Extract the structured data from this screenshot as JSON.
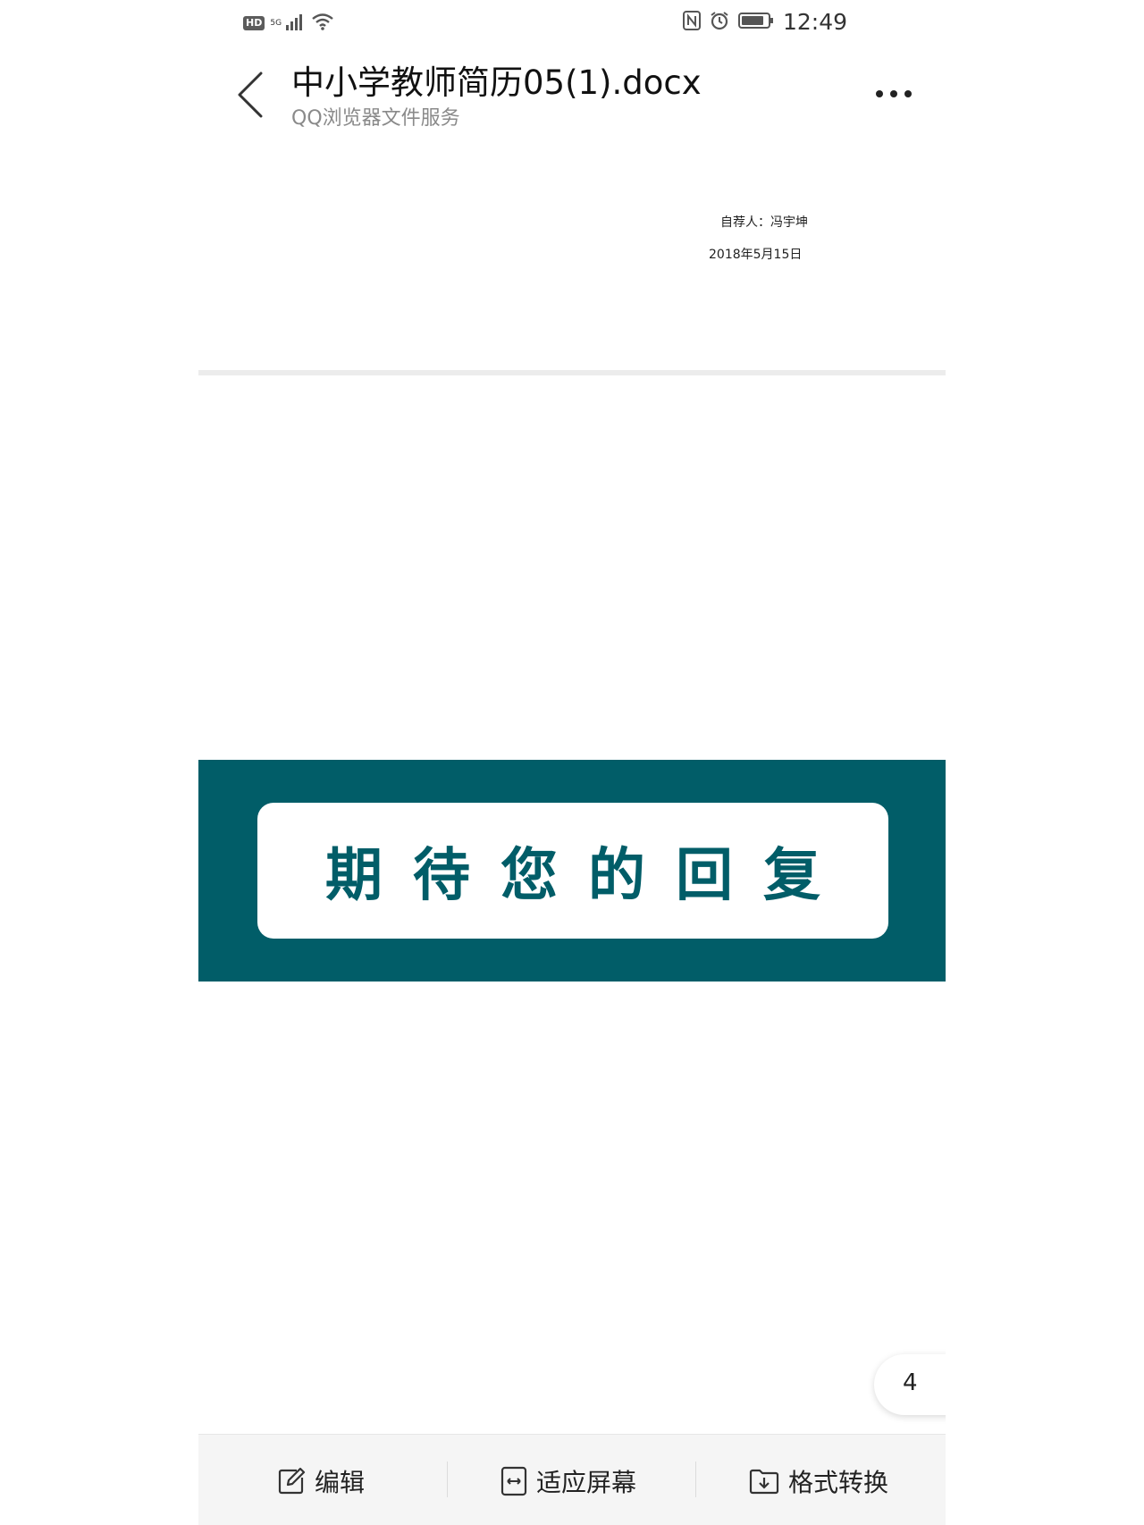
{
  "status_bar": {
    "hd_badge": "HD",
    "network": "5G",
    "time": "12:49",
    "icons": [
      "hd-icon",
      "signal-icon",
      "wifi-icon",
      "nfc-icon",
      "alarm-icon",
      "battery-icon"
    ]
  },
  "header": {
    "title": "中小学教师简历05(1).docx",
    "subtitle": "QQ浏览器文件服务",
    "back_icon": "chevron-left-icon",
    "more_icon": "more-horizontal-icon"
  },
  "document": {
    "author_line": "自荐人：冯宇坤",
    "date_line": "2018年5月15日",
    "banner_text": "期待您的回复",
    "banner_color": "#015d68"
  },
  "page_indicator": "4",
  "toolbar": {
    "edit_label": "编辑",
    "fit_label": "适应屏幕",
    "convert_label": "格式转换"
  }
}
